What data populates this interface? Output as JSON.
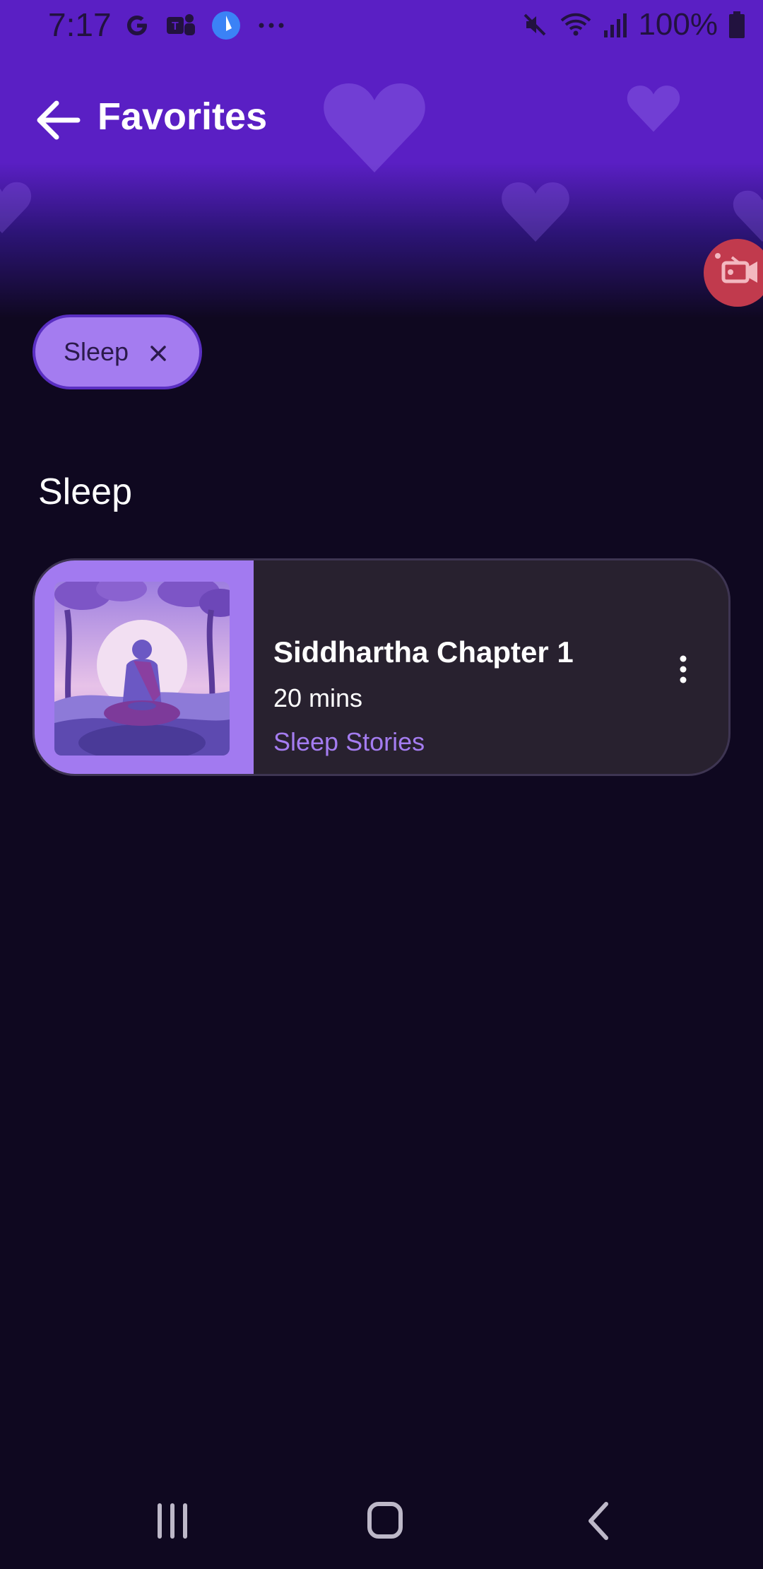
{
  "status_bar": {
    "time": "7:17",
    "battery": "100%",
    "left_icons": [
      "google-icon",
      "teams-icon",
      "app-icon",
      "more-dots-icon"
    ],
    "right_icons": [
      "mute-icon",
      "wifi-icon",
      "signal-icon",
      "battery-icon"
    ]
  },
  "app_bar": {
    "title": "Favorites",
    "back_icon": "arrow-left-icon"
  },
  "filter_chip": {
    "label": "Sleep",
    "close_icon": "close-icon"
  },
  "section": {
    "title": "Sleep"
  },
  "card": {
    "title": "Siddhartha Chapter 1",
    "duration": "20 mins",
    "category": "Sleep Stories",
    "thumbnail": "meditating-monk-illustration",
    "menu_icon": "more-vertical-icon"
  },
  "floating_button": {
    "icon": "video-record-icon"
  },
  "nav_bar": {
    "items": [
      "recent-apps-icon",
      "home-icon",
      "back-icon"
    ]
  },
  "colors": {
    "header": "#5a1fc4",
    "background": "#0f0820",
    "accent": "#a47cf0",
    "card": "#28212f",
    "record": "#c13a4d"
  }
}
